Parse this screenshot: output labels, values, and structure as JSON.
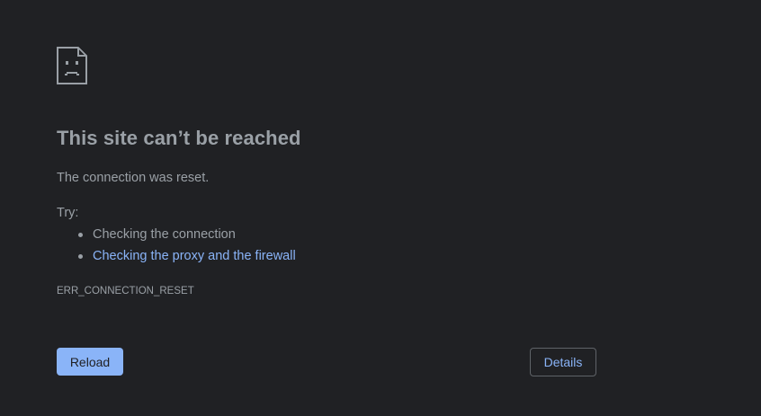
{
  "error": {
    "icon": "sad-page-icon",
    "title": "This site can’t be reached",
    "summary": "The connection was reset.",
    "try_label": "Try:",
    "suggestions": [
      {
        "text": "Checking the connection",
        "is_link": false
      },
      {
        "text": "Checking the proxy and the firewall",
        "is_link": true
      }
    ],
    "code": "ERR_CONNECTION_RESET"
  },
  "buttons": {
    "reload_label": "Reload",
    "details_label": "Details"
  },
  "colors": {
    "background": "#202124",
    "text": "#9aa0a6",
    "link": "#8ab4f8",
    "primary_button": "#8ab4f8",
    "outline": "#5f6368"
  }
}
